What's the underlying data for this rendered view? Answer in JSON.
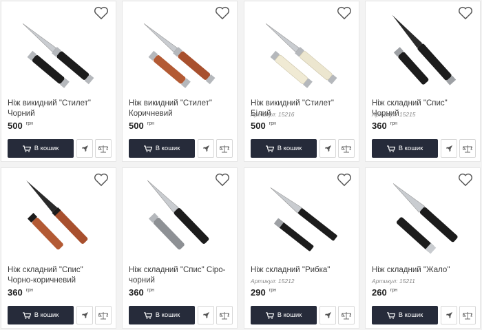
{
  "products": [
    {
      "title": "Ніж викидний \"Стилет\" Чорний",
      "sku": "",
      "price": "500",
      "currency": "грн",
      "cart_label": "В кошик"
    },
    {
      "title": "Ніж викидний \"Стилет\" Коричневий",
      "sku": "",
      "price": "500",
      "currency": "грн",
      "cart_label": "В кошик"
    },
    {
      "title": "Ніж викидний \"Стилет\" Білий",
      "sku": "Артикул: 15216",
      "price": "500",
      "currency": "грн",
      "cart_label": "В кошик"
    },
    {
      "title": "Ніж складний \"Спис\" Чорний",
      "sku": "Артикул: 15215",
      "price": "360",
      "currency": "грн",
      "cart_label": "В кошик"
    },
    {
      "title": "Ніж складний \"Спис\" Чорно-коричневий",
      "sku": "",
      "price": "360",
      "currency": "грн",
      "cart_label": "В кошик"
    },
    {
      "title": "Ніж складний \"Спис\" Сіро-чорний",
      "sku": "",
      "price": "360",
      "currency": "грн",
      "cart_label": "В кошик"
    },
    {
      "title": "Ніж складний \"Рибка\"",
      "sku": "Артикул: 15212",
      "price": "290",
      "currency": "грн",
      "cart_label": "В кошик"
    },
    {
      "title": "Ніж складний \"Жало\"",
      "sku": "Артикул: 15211",
      "price": "260",
      "currency": "грн",
      "cart_label": "В кошик"
    }
  ],
  "icons": {
    "favorite": "heart-icon",
    "cart": "cart-icon",
    "quick_buy": "rocket-icon",
    "compare": "scales-icon"
  },
  "colors": {
    "cart_button": "#262b3a",
    "handle_black": "#1c1c1c",
    "handle_brown": "#a8502e",
    "handle_white": "#ece6cf",
    "blade": "#c9ccd0"
  }
}
